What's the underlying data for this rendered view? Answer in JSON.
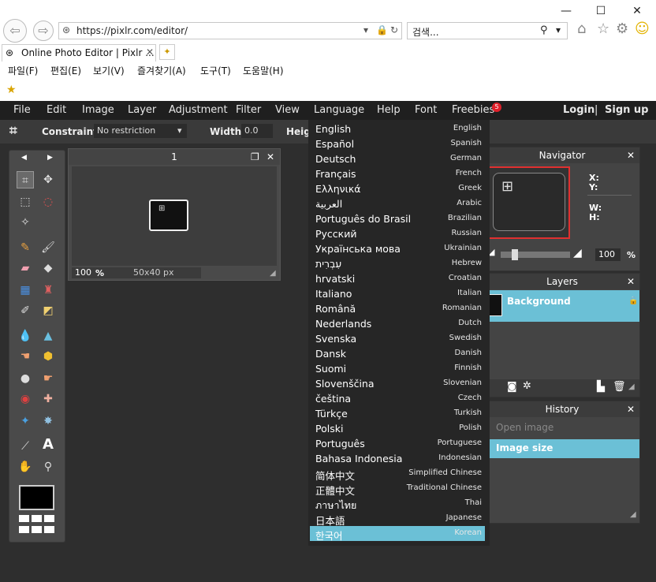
{
  "browser": {
    "url": "https://pixlr.com/editor/",
    "search_placeholder": "검색...",
    "tab_title": "Online Photo Editor | Pixlr ...",
    "menu": [
      "파일(F)",
      "편집(E)",
      "보기(V)",
      "즐겨찾기(A)",
      "도구(T)",
      "도움말(H)"
    ]
  },
  "app": {
    "menu": [
      "File",
      "Edit",
      "Image",
      "Layer",
      "Adjustment",
      "Filter",
      "View",
      "Language",
      "Help",
      "Font",
      "Freebies"
    ],
    "freebies_badge": "5",
    "login": "Login",
    "divider": "|",
    "signup": "Sign up",
    "options": {
      "constraint_label": "Constraint:",
      "constraint_value": "No restriction",
      "width_label": "Width:",
      "width_value": "0.0",
      "height_label": "Heig"
    },
    "document": {
      "title": "1",
      "zoom": "100",
      "zoom_unit": "%",
      "size": "50x40 px"
    },
    "navigator": {
      "title": "Navigator",
      "x_label": "X:",
      "y_label": "Y:",
      "w_label": "W:",
      "h_label": "H:",
      "zoom": "100",
      "zoom_unit": "%"
    },
    "layers": {
      "title": "Layers",
      "layer_name": "Background"
    },
    "history": {
      "title": "History",
      "items": [
        "Open image",
        "Image size"
      ]
    },
    "languages": [
      {
        "native": "English",
        "english": "English"
      },
      {
        "native": "Español",
        "english": "Spanish"
      },
      {
        "native": "Deutsch",
        "english": "German"
      },
      {
        "native": "Français",
        "english": "French"
      },
      {
        "native": "Ελληνικά",
        "english": "Greek"
      },
      {
        "native": "العربية",
        "english": "Arabic"
      },
      {
        "native": "Português do Brasil",
        "english": "Brazilian"
      },
      {
        "native": "Русский",
        "english": "Russian"
      },
      {
        "native": "Українська мова",
        "english": "Ukrainian"
      },
      {
        "native": "עִבְרִית",
        "english": "Hebrew"
      },
      {
        "native": "hrvatski",
        "english": "Croatian"
      },
      {
        "native": "Italiano",
        "english": "Italian"
      },
      {
        "native": "Română",
        "english": "Romanian"
      },
      {
        "native": "Nederlands",
        "english": "Dutch"
      },
      {
        "native": "Svenska",
        "english": "Swedish"
      },
      {
        "native": "Dansk",
        "english": "Danish"
      },
      {
        "native": "Suomi",
        "english": "Finnish"
      },
      {
        "native": "Slovenščina",
        "english": "Slovenian"
      },
      {
        "native": "čeština",
        "english": "Czech"
      },
      {
        "native": "Türkçe",
        "english": "Turkish"
      },
      {
        "native": "Polski",
        "english": "Polish"
      },
      {
        "native": "Português",
        "english": "Portuguese"
      },
      {
        "native": "Bahasa Indonesia",
        "english": "Indonesian"
      },
      {
        "native": "简体中文",
        "english": "Simplified Chinese"
      },
      {
        "native": "正體中文",
        "english": "Traditional Chinese"
      },
      {
        "native": "ภาษาไทย",
        "english": "Thai"
      },
      {
        "native": "日本語",
        "english": "Japanese"
      },
      {
        "native": "한국어",
        "english": "Korean"
      }
    ],
    "selected_language": "Korean",
    "colors": {
      "accent": "#6bc0d6",
      "badge": "#e0202a",
      "menubar": "#1f1f1f",
      "panel": "#444444"
    }
  }
}
